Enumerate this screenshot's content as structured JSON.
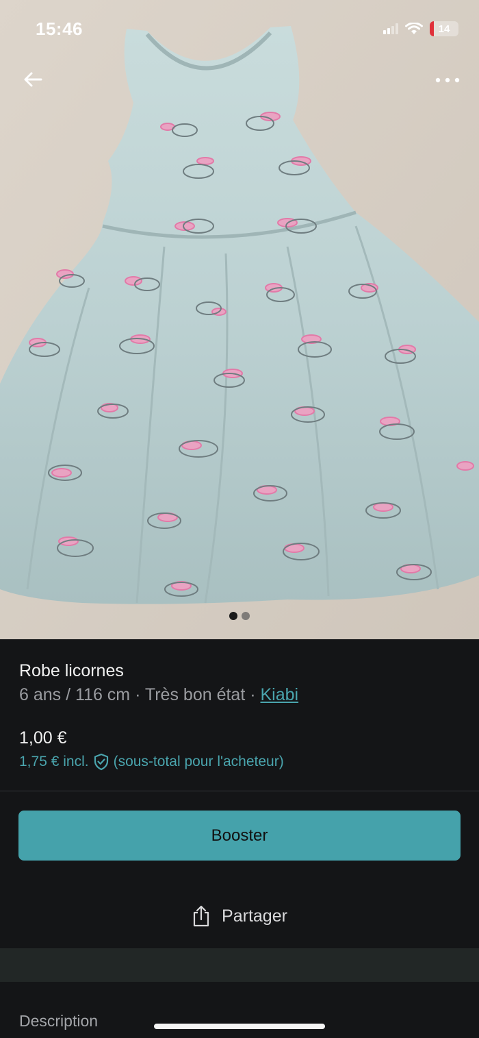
{
  "status_bar": {
    "time": "15:46",
    "battery_level": "14",
    "icons": [
      "signal-icon",
      "wifi-icon",
      "battery-charging-icon"
    ]
  },
  "nav": {
    "back_icon": "arrow-left-icon",
    "more_icon": "more-horizontal-icon"
  },
  "gallery": {
    "photo_count": 2,
    "active_index": 0,
    "image": "light blue unicorn print sleeveless dress on beige surface"
  },
  "item": {
    "title": "Robe licornes",
    "size": "6 ans / 116 cm",
    "sep1": " · ",
    "condition": "Très bon état",
    "sep2": " · ",
    "brand": "Kiabi",
    "price": "1,00 €",
    "price_incl": "1,75 € incl.",
    "price_incl_note": "(sous-total pour l'acheteur)"
  },
  "actions": {
    "booster_label": "Booster",
    "share_label": "Partager"
  },
  "sections": {
    "description_label": "Description"
  },
  "colors": {
    "accent": "#45a2ab",
    "link": "#4aa5ae",
    "background": "#141517",
    "battery_low": "#e0313a"
  }
}
